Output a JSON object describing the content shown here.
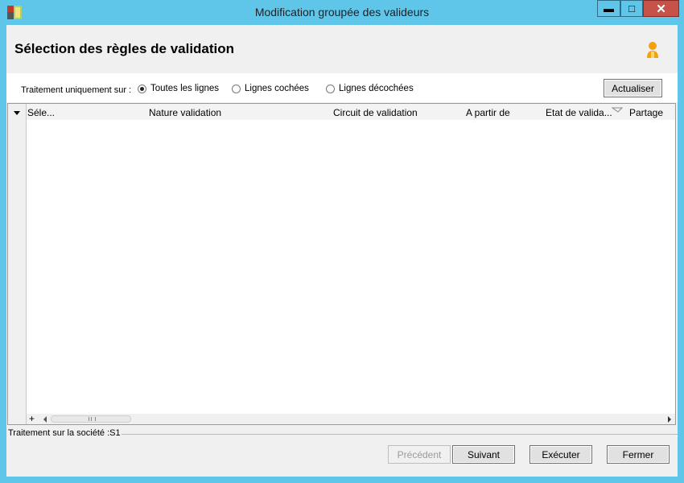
{
  "window": {
    "title": "Modification groupée des valideurs",
    "minimize": "▬",
    "maximize": "□",
    "close": "✕"
  },
  "header": {
    "title": "Sélection des règles de validation"
  },
  "filter": {
    "label": "Traitement uniquement sur :",
    "options": [
      {
        "label": "Toutes les lignes",
        "selected": true
      },
      {
        "label": "Lignes cochées",
        "selected": false
      },
      {
        "label": "Lignes décochées",
        "selected": false
      }
    ],
    "refresh": "Actualiser"
  },
  "grid": {
    "columns": [
      "Séle...",
      "Nature validation",
      "Circuit de validation",
      "A partir de",
      "Etat de valida...",
      "Partage"
    ],
    "rows": []
  },
  "status": {
    "text": "Traitement sur la société :S1"
  },
  "buttons": {
    "previous": "Précédent",
    "next": "Suivant",
    "execute": "Exécuter",
    "close": "Fermer"
  },
  "colors": {
    "frame": "#5fc6ea",
    "close": "#c7524a",
    "panel": "#f0f0f0"
  }
}
